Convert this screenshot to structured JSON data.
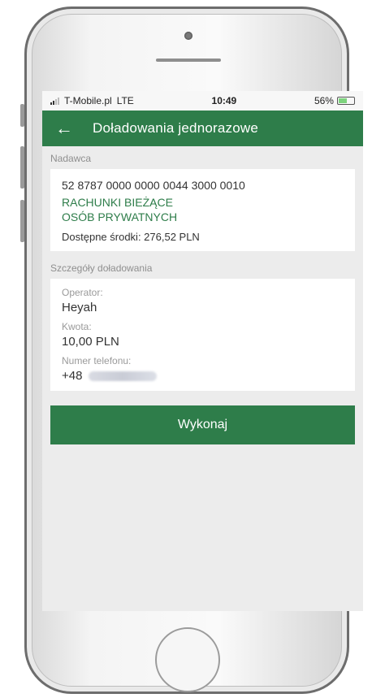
{
  "status_bar": {
    "carrier": "T-Mobile.pl",
    "network": "LTE",
    "time": "10:49",
    "battery": "56%",
    "battery_level": 0.56
  },
  "app_bar": {
    "back_icon": "arrow-left-icon",
    "title": "Doładowania jednorazowe"
  },
  "sender": {
    "section_label": "Nadawca",
    "account_number": "52 8787 0000 0000 0044 3000 0010",
    "account_name_line1": "RACHUNKI BIEŻĄCE",
    "account_name_line2": "OSÓB PRYWATNYCH",
    "available_funds": "Dostępne środki: 276,52 PLN"
  },
  "details": {
    "section_label": "Szczegóły doładowania",
    "operator_label": "Operator:",
    "operator_value": "Heyah",
    "amount_label": "Kwota:",
    "amount_value": "10,00 PLN",
    "phone_label": "Numer telefonu:",
    "phone_prefix": "+48"
  },
  "actions": {
    "execute_label": "Wykonaj"
  },
  "colors": {
    "brand": "#2e7d4a",
    "screen_bg": "#ececec"
  }
}
